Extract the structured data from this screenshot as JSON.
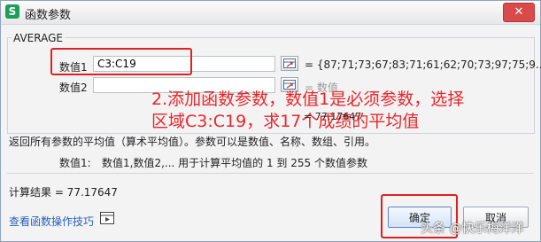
{
  "window": {
    "title": "函数参数",
    "app_icon_letter": "S",
    "close_label": "✕"
  },
  "function_name": "AVERAGE",
  "arguments": [
    {
      "label": "数值1",
      "value": "C3:C19",
      "result": "= {87;71;73;67;83;71;61;62;70;73;97;75;9..."
    },
    {
      "label": "数值2",
      "value": "",
      "result": "= 数值"
    }
  ],
  "annotation": {
    "line1": "2.添加函数参数，数值1是必须参数，选择",
    "line2": "区域C3:C19，求17个成绩的平均值"
  },
  "inline_result": "= 77.17647",
  "description": "返回所有参数的平均值（算术平均值）。参数可以是数值、名称、数组、引用。",
  "arg_description": {
    "name": "数值1:",
    "text": "数值1,数值2,... 用于计算平均值的 1 到 255 个数值参数"
  },
  "calc_result": "计算结果 = 77.17647",
  "help_link": "查看函数操作技巧",
  "buttons": {
    "ok": "确定",
    "cancel": "取消"
  },
  "watermark": "头条 @快乐梅洋洋",
  "colors": {
    "annotation": "#e8262a",
    "highlight_box": "#e02020",
    "link": "#2763b8"
  }
}
